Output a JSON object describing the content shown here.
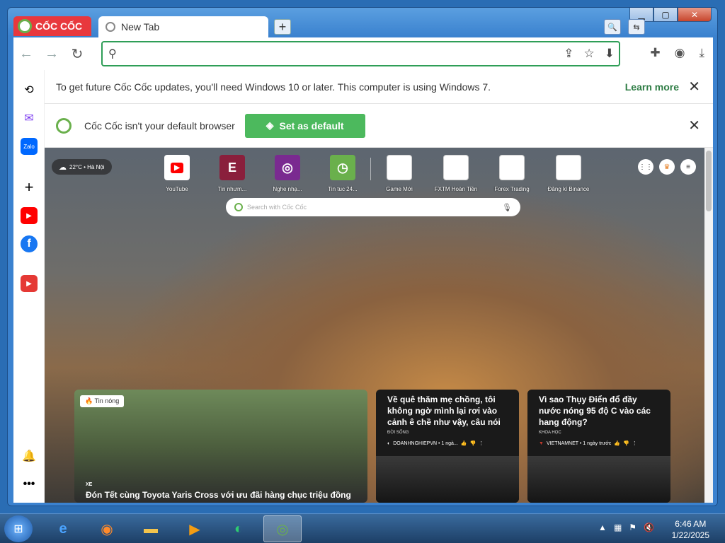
{
  "window": {
    "brand": "CỐC CỐC",
    "tab_title": "New Tab",
    "new_tab_symbol": "+",
    "controls": {
      "minimize": "▁",
      "maximize": "▢",
      "close": "✕"
    }
  },
  "toolbar": {
    "omnibox_placeholder": ""
  },
  "infobar_update": {
    "text": "To get future Cốc Cốc updates, you'll need Windows 10 or later. This computer is using Windows 7.",
    "link": "Learn more"
  },
  "infobar_default": {
    "text": "Cốc Cốc isn't your default browser",
    "button": "Set as default"
  },
  "weather": {
    "text": "22°C • Hà Nội"
  },
  "speed_dials": [
    {
      "label": "YouTube",
      "icon": "youtube-icon",
      "color": "#ff0000"
    },
    {
      "label": "Tin nhưm...",
      "icon": "e-icon",
      "color": "#8a1f3c"
    },
    {
      "label": "Nghe nhạ...",
      "icon": "music-icon",
      "color": "#7a2a90"
    },
    {
      "label": "Tin tuc 24...",
      "icon": "clock-icon",
      "color": "#6ab04c"
    },
    {
      "label": "Game Mới",
      "icon": "blank-icon",
      "color": "#ffffff"
    },
    {
      "label": "FXTM Hoàn Tiền",
      "icon": "blank-icon",
      "color": "#ffffff"
    },
    {
      "label": "Forex Trading",
      "icon": "blank-icon",
      "color": "#ffffff"
    },
    {
      "label": "Đăng kí Binance",
      "icon": "blank-icon",
      "color": "#ffffff"
    }
  ],
  "ntp_search": {
    "placeholder": "Search with Cốc Cốc"
  },
  "news": {
    "big": {
      "badge": "Tin nóng",
      "category": "XE",
      "title": "Đón Tết cùng Toyota Yaris Cross với ưu đãi hàng chục triệu đồng"
    },
    "small": [
      {
        "title": "Về quê thăm mẹ chồng, tôi không ngờ mình lại rơi vào cảnh ê chề như vậy, câu nói ca...",
        "category": "ĐỜI SỐNG",
        "source": "DOANHNGHIEPVN • 1 ngà..."
      },
      {
        "title": "Vì sao Thụy Điển đổ đầy nước nóng 95 độ C vào các hang động?",
        "category": "KHOA HỌC",
        "source": "VIETNAMNET • 1 ngày trước"
      }
    ]
  },
  "taskbar": {
    "time": "6:46 AM",
    "date": "1/22/2025"
  }
}
